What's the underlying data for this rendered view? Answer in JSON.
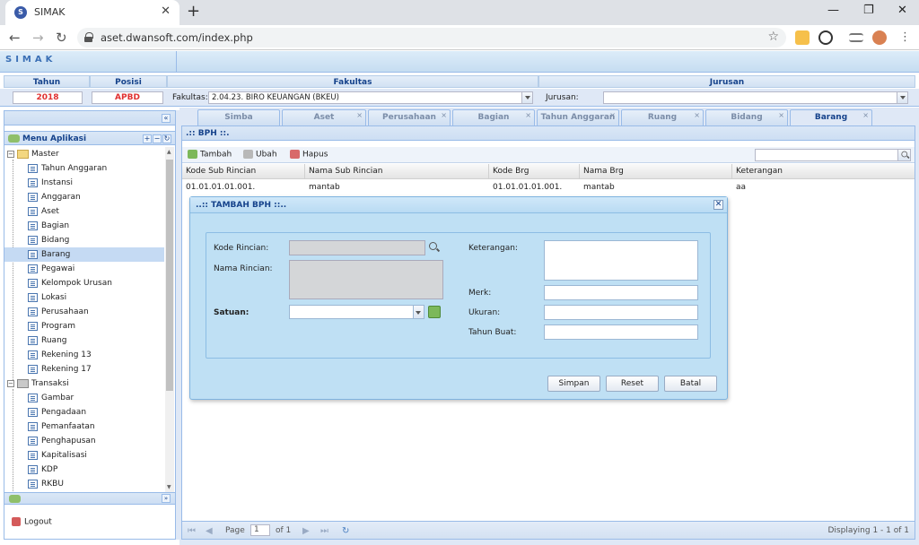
{
  "browser": {
    "tab_title": "SIMAK",
    "url": "aset.dwansoft.com/index.php"
  },
  "app": {
    "logo": "SIMAK"
  },
  "filters": {
    "tahun_label": "Tahun",
    "posisi_label": "Posisi",
    "fakultas_label": "Fakultas",
    "jurusan_label": "Jurusan",
    "tahun_value": "2018",
    "posisi_value": "APBD",
    "fakultas_field_label": "Fakultas:",
    "fakultas_value": "2.04.23. BIRO KEUANGAN (BKEU)",
    "jurusan_field_label": "Jurusan:",
    "jurusan_value": ""
  },
  "sidebar": {
    "title": "Menu Aplikasi",
    "master_label": "Master",
    "master_items": [
      "Tahun Anggaran",
      "Instansi",
      "Anggaran",
      "Aset",
      "Bagian",
      "Bidang",
      "Barang",
      "Pegawai",
      "Kelompok Urusan",
      "Lokasi",
      "Perusahaan",
      "Program",
      "Ruang",
      "Rekening 13",
      "Rekening 17"
    ],
    "transaksi_label": "Transaksi",
    "transaksi_items": [
      "Gambar",
      "Pengadaan",
      "Pemanfaatan",
      "Penghapusan",
      "Kapitalisasi",
      "KDP",
      "RKBU"
    ],
    "selected": "Barang",
    "logout": "Logout"
  },
  "tabs": [
    "Simba",
    "Aset",
    "Perusahaan",
    "Bagian",
    "Tahun Anggaran",
    "Ruang",
    "Bidang",
    "Barang"
  ],
  "active_tab": "Barang",
  "panel": {
    "title": ".:: BPH ::.",
    "toolbar": {
      "add": "Tambah",
      "edit": "Ubah",
      "delete": "Hapus"
    },
    "columns": [
      "Kode Sub Rincian",
      "Nama Sub Rincian",
      "Kode Brg",
      "Nama Brg",
      "Keterangan"
    ],
    "rows": [
      [
        "01.01.01.01.001.",
        "mantab",
        "01.01.01.01.001.",
        "mantab",
        "aa"
      ]
    ],
    "pager": {
      "page_label": "Page",
      "page_value": "1",
      "of_label": "of 1",
      "displaying": "Displaying 1 - 1 of 1"
    }
  },
  "dialog": {
    "title": "..:: TAMBAH BPH ::..",
    "kode_rincian": "Kode Rincian:",
    "nama_rincian": "Nama Rincian:",
    "satuan": "Satuan:",
    "keterangan": "Keterangan:",
    "merk": "Merk:",
    "ukuran": "Ukuran:",
    "tahun_buat": "Tahun Buat:",
    "save": "Simpan",
    "reset": "Reset",
    "cancel": "Batal"
  },
  "colors": {
    "accent": "#15428b",
    "highlight": "#e03030",
    "selection": "#c5daf3"
  },
  "icons": [
    "favicon-icon",
    "close-tab-icon",
    "new-tab-icon",
    "back-icon",
    "forward-icon",
    "reload-icon",
    "lock-icon",
    "star-icon",
    "search-icon",
    "folder-icon",
    "document-icon",
    "add-icon",
    "edit-icon",
    "delete-icon",
    "close-icon",
    "dropdown-icon"
  ]
}
